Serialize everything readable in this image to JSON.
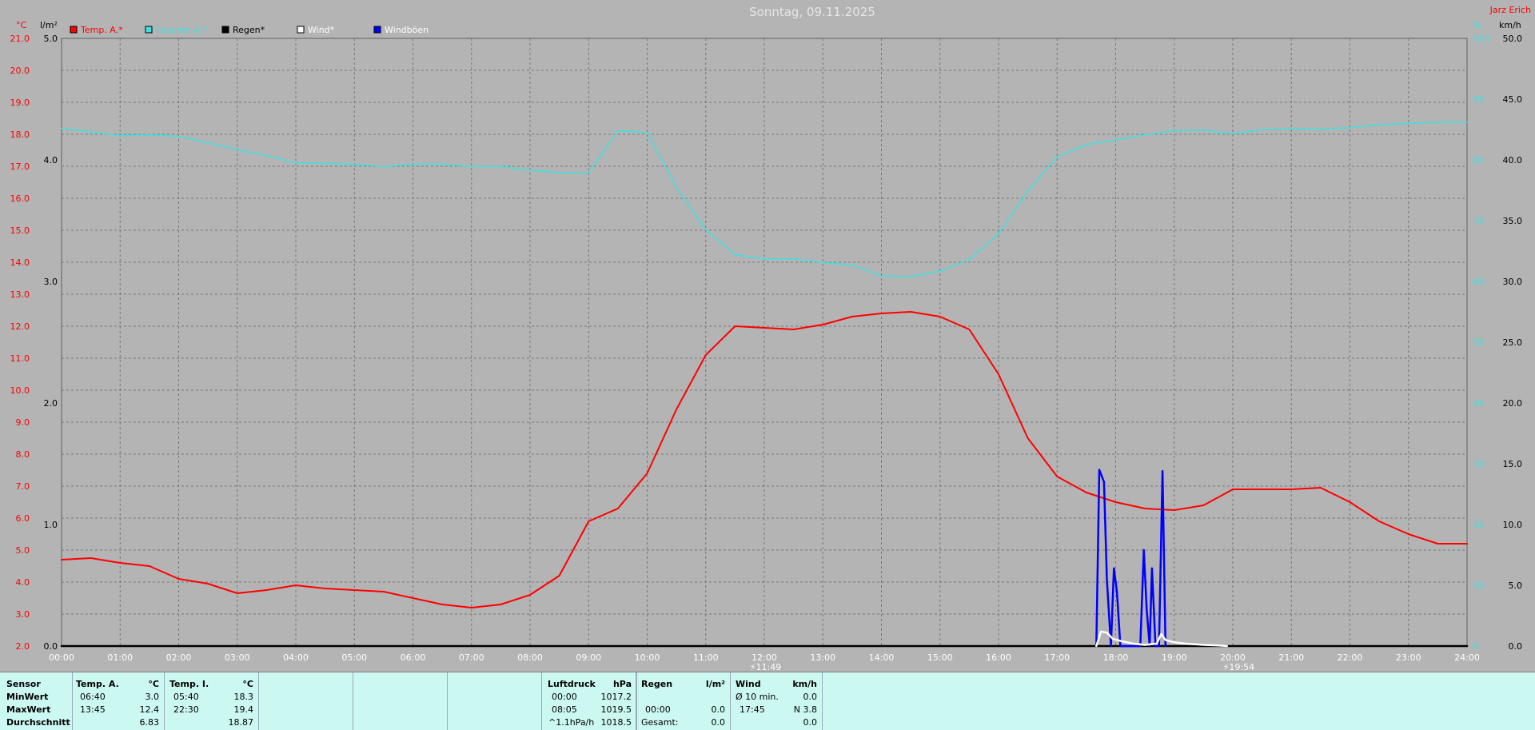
{
  "chart_data": {
    "type": "line",
    "title": "Sonntag, 09.11.2025",
    "corner_label": "Jarz Erich",
    "x_ticks": [
      "00:00",
      "01:00",
      "02:00",
      "03:00",
      "04:00",
      "05:00",
      "06:00",
      "07:00",
      "08:00",
      "09:00",
      "10:00",
      "11:00",
      "12:00",
      "13:00",
      "14:00",
      "15:00",
      "16:00",
      "17:00",
      "18:00",
      "19:00",
      "20:00",
      "21:00",
      "22:00",
      "23:00",
      "24:00"
    ],
    "x_range_hours": [
      0,
      24
    ],
    "axes": {
      "temp": {
        "unit": "°C",
        "min": 2.0,
        "max": 21.0,
        "ticks": [
          "2.0",
          "3.0",
          "4.0",
          "5.0",
          "6.0",
          "7.0",
          "8.0",
          "9.0",
          "10.0",
          "11.0",
          "12.0",
          "13.0",
          "14.0",
          "15.0",
          "16.0",
          "17.0",
          "18.0",
          "19.0",
          "20.0",
          "21.0"
        ],
        "color": "#ff0000"
      },
      "rain": {
        "unit": "l/m²",
        "min": 0.0,
        "max": 5.0,
        "ticks": [
          "0.0",
          "1.0",
          "2.0",
          "3.0",
          "4.0",
          "5.0"
        ],
        "color": "#000000"
      },
      "humidity": {
        "unit": "%",
        "min": 0,
        "max": 100,
        "ticks": [
          "0",
          "10",
          "20",
          "30",
          "40",
          "50",
          "60",
          "70",
          "80",
          "90",
          "100"
        ],
        "color": "#40e0e0"
      },
      "wind": {
        "unit": "km/h",
        "min": 0.0,
        "max": 50.0,
        "ticks": [
          "0.0",
          "5.0",
          "10.0",
          "15.0",
          "20.0",
          "25.0",
          "30.0",
          "35.0",
          "40.0",
          "45.0",
          "50.0"
        ],
        "color": "#000000"
      }
    },
    "legend": [
      {
        "name": "Temp. A.*",
        "color": "#ff0000",
        "text_color": "#ff0000"
      },
      {
        "name": "Feuchte A.*",
        "color": "#40e0e0",
        "text_color": "#40e0e0"
      },
      {
        "name": "Regen*",
        "color": "#000000",
        "text_color": "#000000"
      },
      {
        "name": "Wind*",
        "color": "#ffffff",
        "text_color": "#ffffff"
      },
      {
        "name": "Windböen",
        "color": "#0000ff",
        "text_color": "#ffffff"
      }
    ],
    "markers": [
      {
        "x": 11.82,
        "label": "11:49"
      },
      {
        "x": 19.9,
        "label": "19:54"
      }
    ],
    "series": [
      {
        "name": "Temp. A.*",
        "axis": "temp",
        "color": "#ff0000",
        "points": [
          [
            0,
            4.7
          ],
          [
            0.5,
            4.75
          ],
          [
            1,
            4.6
          ],
          [
            1.5,
            4.5
          ],
          [
            2,
            4.1
          ],
          [
            2.5,
            3.95
          ],
          [
            3,
            3.65
          ],
          [
            3.5,
            3.75
          ],
          [
            4,
            3.9
          ],
          [
            4.5,
            3.8
          ],
          [
            5,
            3.75
          ],
          [
            5.5,
            3.7
          ],
          [
            6,
            3.5
          ],
          [
            6.5,
            3.3
          ],
          [
            7,
            3.2
          ],
          [
            7.5,
            3.3
          ],
          [
            8,
            3.6
          ],
          [
            8.5,
            4.2
          ],
          [
            9,
            5.9
          ],
          [
            9.5,
            6.3
          ],
          [
            10,
            7.4
          ],
          [
            10.5,
            9.4
          ],
          [
            11,
            11.1
          ],
          [
            11.5,
            12.0
          ],
          [
            12,
            11.95
          ],
          [
            12.5,
            11.9
          ],
          [
            13,
            12.05
          ],
          [
            13.5,
            12.3
          ],
          [
            14,
            12.4
          ],
          [
            14.5,
            12.45
          ],
          [
            15,
            12.3
          ],
          [
            15.5,
            11.9
          ],
          [
            16,
            10.5
          ],
          [
            16.5,
            8.5
          ],
          [
            17,
            7.3
          ],
          [
            17.5,
            6.8
          ],
          [
            18,
            6.5
          ],
          [
            18.5,
            6.3
          ],
          [
            19,
            6.25
          ],
          [
            19.5,
            6.4
          ],
          [
            20,
            6.9
          ],
          [
            20.5,
            6.9
          ],
          [
            21,
            6.9
          ],
          [
            21.5,
            6.95
          ],
          [
            22,
            6.5
          ],
          [
            22.5,
            5.9
          ],
          [
            23,
            5.5
          ],
          [
            23.5,
            5.2
          ],
          [
            24,
            5.2
          ]
        ]
      },
      {
        "name": "Feuchte A.*",
        "axis": "humidity",
        "color": "#40e0e0",
        "points": [
          [
            0,
            85.2
          ],
          [
            0.5,
            84.6
          ],
          [
            1,
            84
          ],
          [
            1.5,
            84.1
          ],
          [
            2,
            83.9
          ],
          [
            2.5,
            82.8
          ],
          [
            3,
            81.7
          ],
          [
            3.5,
            80.7
          ],
          [
            4,
            79.5
          ],
          [
            4.5,
            79.4
          ],
          [
            5,
            79.3
          ],
          [
            5.5,
            78.9
          ],
          [
            6,
            79.3
          ],
          [
            6.5,
            79.3
          ],
          [
            7,
            78.9
          ],
          [
            7.5,
            78.9
          ],
          [
            8,
            78.3
          ],
          [
            8.5,
            77.9
          ],
          [
            9,
            77.9
          ],
          [
            9.5,
            84.8
          ],
          [
            10,
            84.5
          ],
          [
            10.5,
            75.5
          ],
          [
            11,
            68.5
          ],
          [
            11.5,
            64.4
          ],
          [
            12,
            63.7
          ],
          [
            12.5,
            63.7
          ],
          [
            13,
            63.1
          ],
          [
            13.5,
            62.7
          ],
          [
            14,
            60.9
          ],
          [
            14.5,
            60.8
          ],
          [
            15,
            61.7
          ],
          [
            15.5,
            63.6
          ],
          [
            16,
            67.8
          ],
          [
            16.5,
            74.9
          ],
          [
            17,
            80.5
          ],
          [
            17.5,
            82.5
          ],
          [
            18,
            83.3
          ],
          [
            18.5,
            84.1
          ],
          [
            19,
            84.8
          ],
          [
            19.5,
            84.9
          ],
          [
            20,
            84.3
          ],
          [
            20.5,
            85.0
          ],
          [
            21,
            85.2
          ],
          [
            21.5,
            85.1
          ],
          [
            22,
            85.3
          ],
          [
            22.5,
            85.8
          ],
          [
            23,
            86.0
          ],
          [
            23.5,
            86.2
          ],
          [
            24,
            86.2
          ]
        ]
      },
      {
        "name": "Regen*",
        "axis": "rain",
        "color": "#000000",
        "points": [
          [
            0,
            0
          ],
          [
            24,
            0
          ]
        ]
      },
      {
        "name": "Windböen",
        "axis": "wind",
        "color": "#0000ff",
        "points": [
          [
            17.67,
            0
          ],
          [
            17.72,
            14.5
          ],
          [
            17.8,
            13.5
          ],
          [
            17.85,
            5.5
          ],
          [
            17.92,
            0
          ],
          [
            17.97,
            6.4
          ],
          [
            18.02,
            4.5
          ],
          [
            18.08,
            0
          ],
          [
            18.42,
            0
          ],
          [
            18.48,
            7.9
          ],
          [
            18.53,
            3.0
          ],
          [
            18.58,
            0
          ],
          [
            18.62,
            6.4
          ],
          [
            18.68,
            0
          ],
          [
            18.74,
            0
          ],
          [
            18.8,
            14.4
          ],
          [
            18.85,
            0
          ]
        ]
      },
      {
        "name": "Wind*",
        "axis": "wind",
        "color": "#ffffff",
        "points": [
          [
            17.67,
            0
          ],
          [
            17.75,
            1.2
          ],
          [
            17.85,
            1.1
          ],
          [
            17.95,
            0.6
          ],
          [
            18.1,
            0.4
          ],
          [
            18.3,
            0.2
          ],
          [
            18.5,
            0.1
          ],
          [
            18.7,
            0.2
          ],
          [
            18.78,
            1.0
          ],
          [
            18.85,
            0.5
          ],
          [
            19,
            0.3
          ],
          [
            19.2,
            0.2
          ],
          [
            19.5,
            0.1
          ],
          [
            19.75,
            0.05
          ],
          [
            19.9,
            0
          ]
        ]
      }
    ]
  },
  "panel": {
    "sensor": {
      "header": "Sensor",
      "rows": [
        "MinWert",
        "MaxWert",
        "Durchschnitt"
      ]
    },
    "temp_a": {
      "header": "Temp. A.",
      "unit": "°C",
      "rows": [
        [
          "06:40",
          "3.0"
        ],
        [
          "13:45",
          "12.4"
        ],
        [
          "",
          "6.83"
        ]
      ]
    },
    "temp_i": {
      "header": "Temp. I.",
      "unit": "°C",
      "rows": [
        [
          "05:40",
          "18.3"
        ],
        [
          "22:30",
          "19.4"
        ],
        [
          "",
          "18.87"
        ]
      ]
    },
    "pressure": {
      "header": "Luftdruck",
      "unit": "hPa",
      "rows": [
        [
          "00:00",
          "1017.2"
        ],
        [
          "08:05",
          "1019.5"
        ],
        [
          "^1.1hPa/h",
          "1018.5"
        ]
      ]
    },
    "rain": {
      "header": "Regen",
      "unit": "l/m²",
      "rows": [
        [
          "",
          ""
        ],
        [
          "00:00",
          "0.0"
        ],
        [
          "Gesamt:",
          "0.0"
        ]
      ]
    },
    "wind": {
      "header": "Wind",
      "unit": "km/h",
      "rows": [
        [
          "Ø 10 min.",
          "0.0"
        ],
        [
          "17:45",
          "N 3.8"
        ],
        [
          "",
          "0.0"
        ]
      ]
    }
  }
}
